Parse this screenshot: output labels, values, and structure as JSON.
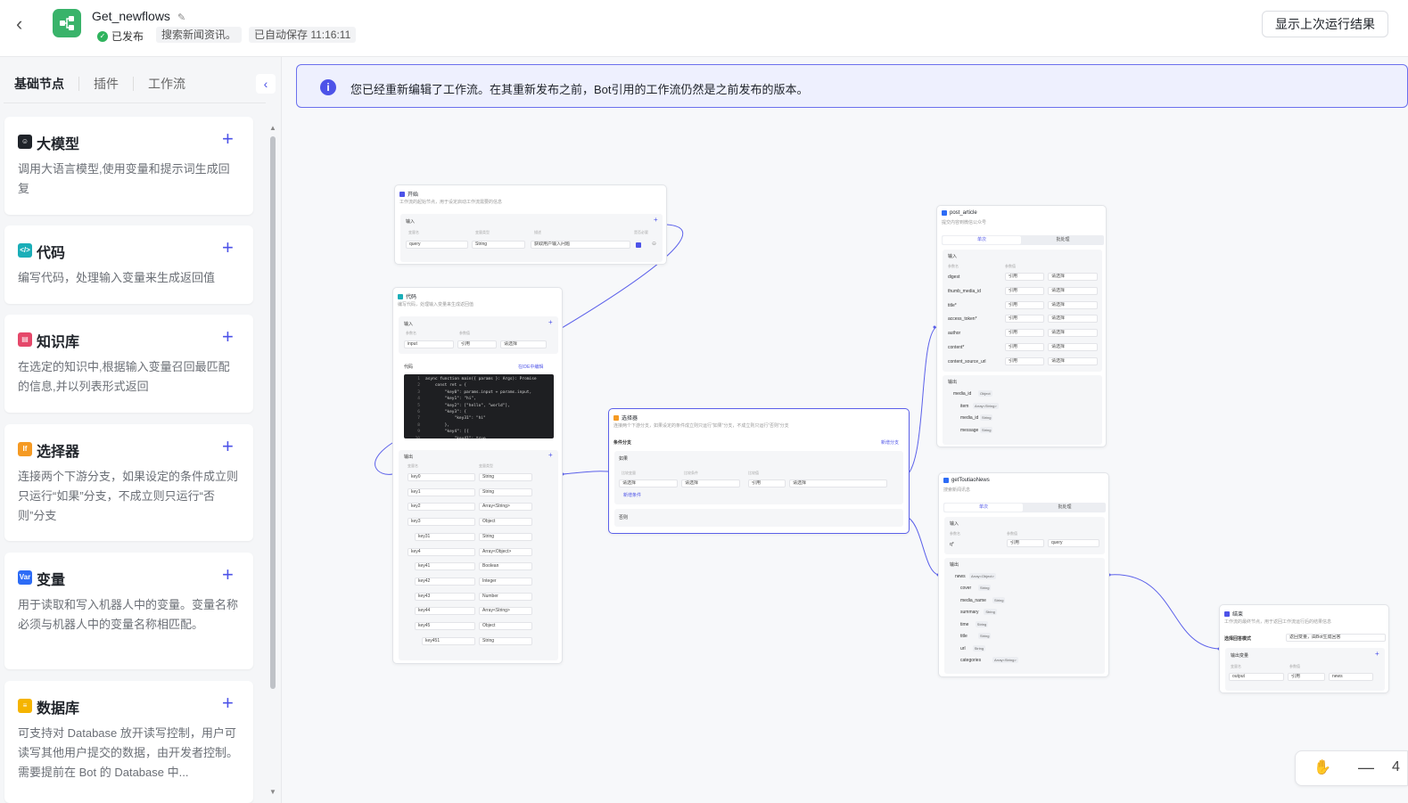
{
  "header": {
    "title": "Get_newflows",
    "status": "已发布",
    "description": "搜索新闻资讯。",
    "autosave": "已自动保存 11:16:11",
    "show_last_run": "显示上次运行结果"
  },
  "sidebar": {
    "tabs": [
      "基础节点",
      "插件",
      "工作流"
    ],
    "cards": [
      {
        "title": "大模型",
        "desc": "调用大语言模型,使用变量和提示词生成回复",
        "icon_color": "#1f2329",
        "icon": "robot-icon"
      },
      {
        "title": "代码",
        "desc": "编写代码，处理输入变量来生成返回值",
        "icon_color": "#1aaeb8",
        "icon": "code-icon"
      },
      {
        "title": "知识库",
        "desc": "在选定的知识中,根据输入变量召回最匹配的信息,并以列表形式返回",
        "icon_color": "#e5486a",
        "icon": "book-icon"
      },
      {
        "title": "选择器",
        "desc": "连接两个下游分支，如果设定的条件成立则只运行“如果”分支，不成立则只运行“否则”分支",
        "icon_color": "#f59a23",
        "icon": "if-icon"
      },
      {
        "title": "变量",
        "desc": "用于读取和写入机器人中的变量。变量名称必须与机器人中的变量名称相匹配。",
        "icon_color": "#2d6cf6",
        "icon": "var-icon"
      },
      {
        "title": "数据库",
        "desc": "可支持对 Database 放开读写控制，用户可读写其他用户提交的数据，由开发者控制。需要提前在 Bot 的 Database 中...",
        "icon_color": "#f5b400",
        "icon": "database-icon"
      }
    ]
  },
  "banner": {
    "text": "您已经重新编辑了工作流。在其重新发布之前，Bot引用的工作流仍然是之前发布的版本。"
  },
  "nodes": {
    "start": {
      "title": "开始",
      "desc": "工作流的起始节点，用于设定启动工作流需要的信息",
      "section": "输入",
      "col1": "变量名",
      "col2": "变量类型",
      "col3": "描述",
      "col4": "是否必要",
      "var": "query",
      "type": "String",
      "description": "获取用户输入问题"
    },
    "code": {
      "title": "代码",
      "desc": "编写代码，处理输入变量来生成返回值",
      "input_label": "输入",
      "col_name": "参数名",
      "col_value": "参数值",
      "input_var": "input",
      "ref": "引用",
      "select": "请选择",
      "code_label": "代码",
      "ide_link": "在IDE中编辑",
      "code_lines": "async function main({ params }: Args): Promise\n    const ret = {\n        \"key0\": params.input + params.input,\n        \"key1\": \"hi\",\n        \"key2\": [\"hello\", \"world\"],\n        \"key3\": {\n            \"key31\": \"hi\"\n        },\n        \"key4\": [{\n            \"key41\": true,",
      "line_numbers": "1\n2\n3\n4\n5\n6\n7\n8\n9\n10",
      "output_label": "输出",
      "out_col1": "变量名",
      "out_col2": "变量类型",
      "outputs": [
        {
          "name": "key0",
          "type": "String",
          "indent": 0
        },
        {
          "name": "key1",
          "type": "String",
          "indent": 0
        },
        {
          "name": "key2",
          "type": "Array<String>",
          "indent": 0
        },
        {
          "name": "key3",
          "type": "Object",
          "indent": 0
        },
        {
          "name": "key31",
          "type": "String",
          "indent": 1
        },
        {
          "name": "key4",
          "type": "Array<Object>",
          "indent": 0
        },
        {
          "name": "key41",
          "type": "Boolean",
          "indent": 1
        },
        {
          "name": "key42",
          "type": "Integer",
          "indent": 1
        },
        {
          "name": "key43",
          "type": "Number",
          "indent": 1
        },
        {
          "name": "key44",
          "type": "Array<String>",
          "indent": 1
        },
        {
          "name": "key45",
          "type": "Object",
          "indent": 1
        },
        {
          "name": "key451",
          "type": "String",
          "indent": 2
        }
      ]
    },
    "selector": {
      "title": "选择器",
      "desc": "连接两个下游分支，如果设定的条件成立则只运行“如果”分支，不成立则只运行“否则”分支",
      "branch_label": "条件分支",
      "add_branch": "新增分支",
      "if_label": "如果",
      "c1": "比较变量",
      "c2": "比较条件",
      "c3": "比较值",
      "s1": "请选择",
      "s2": "请选择",
      "s3": "引用",
      "s4": "请选择",
      "add_cond": "新增条件",
      "else_label": "否则"
    },
    "post": {
      "title": "post_article",
      "desc": "提交内容到微信公众号",
      "tab1": "单次",
      "tab2": "批处理",
      "input_label": "输入",
      "col1": "参数名",
      "col2": "参数值",
      "params": [
        "digest",
        "thumb_media_id",
        "title*",
        "access_token*",
        "author",
        "content*",
        "content_source_url"
      ],
      "ref": "引用",
      "select": "请选择",
      "output_label": "输出",
      "out1": "media_id",
      "out1_type": "Object",
      "out2": "item",
      "out2_type": "Array<String>",
      "out3": "media_id",
      "out3_type": "String",
      "out4": "message",
      "out4_type": "String"
    },
    "news": {
      "title": "getToutiaoNews",
      "desc": "搜索新闻讯息",
      "tab1": "单次",
      "tab2": "批处理",
      "input_label": "输入",
      "col1": "参数名",
      "col2": "参数值",
      "param": "q*",
      "ref": "引用",
      "value": "query",
      "output_label": "输出",
      "out_root": "news",
      "out_root_type": "Array<Object>",
      "outputs": [
        {
          "name": "cover",
          "type": "String"
        },
        {
          "name": "media_name",
          "type": "String"
        },
        {
          "name": "summary",
          "type": "String"
        },
        {
          "name": "time",
          "type": "String"
        },
        {
          "name": "title",
          "type": "String"
        },
        {
          "name": "url",
          "type": "String"
        },
        {
          "name": "categories",
          "type": "Array<String>"
        }
      ]
    },
    "end": {
      "title": "结束",
      "desc": "工作流的最终节点，用于返回工作流运行后的结果信息",
      "mode_label": "选择回答模式",
      "mode_value": "返回变量，由Bot生成回答",
      "output_label": "输出变量",
      "col1": "变量名",
      "col2": "参数值",
      "var": "output",
      "ref": "引用",
      "value": "news"
    }
  },
  "zoom": {
    "value": "4"
  },
  "colors": {
    "accent": "#4d53e8",
    "edge": "#5b60ea"
  }
}
